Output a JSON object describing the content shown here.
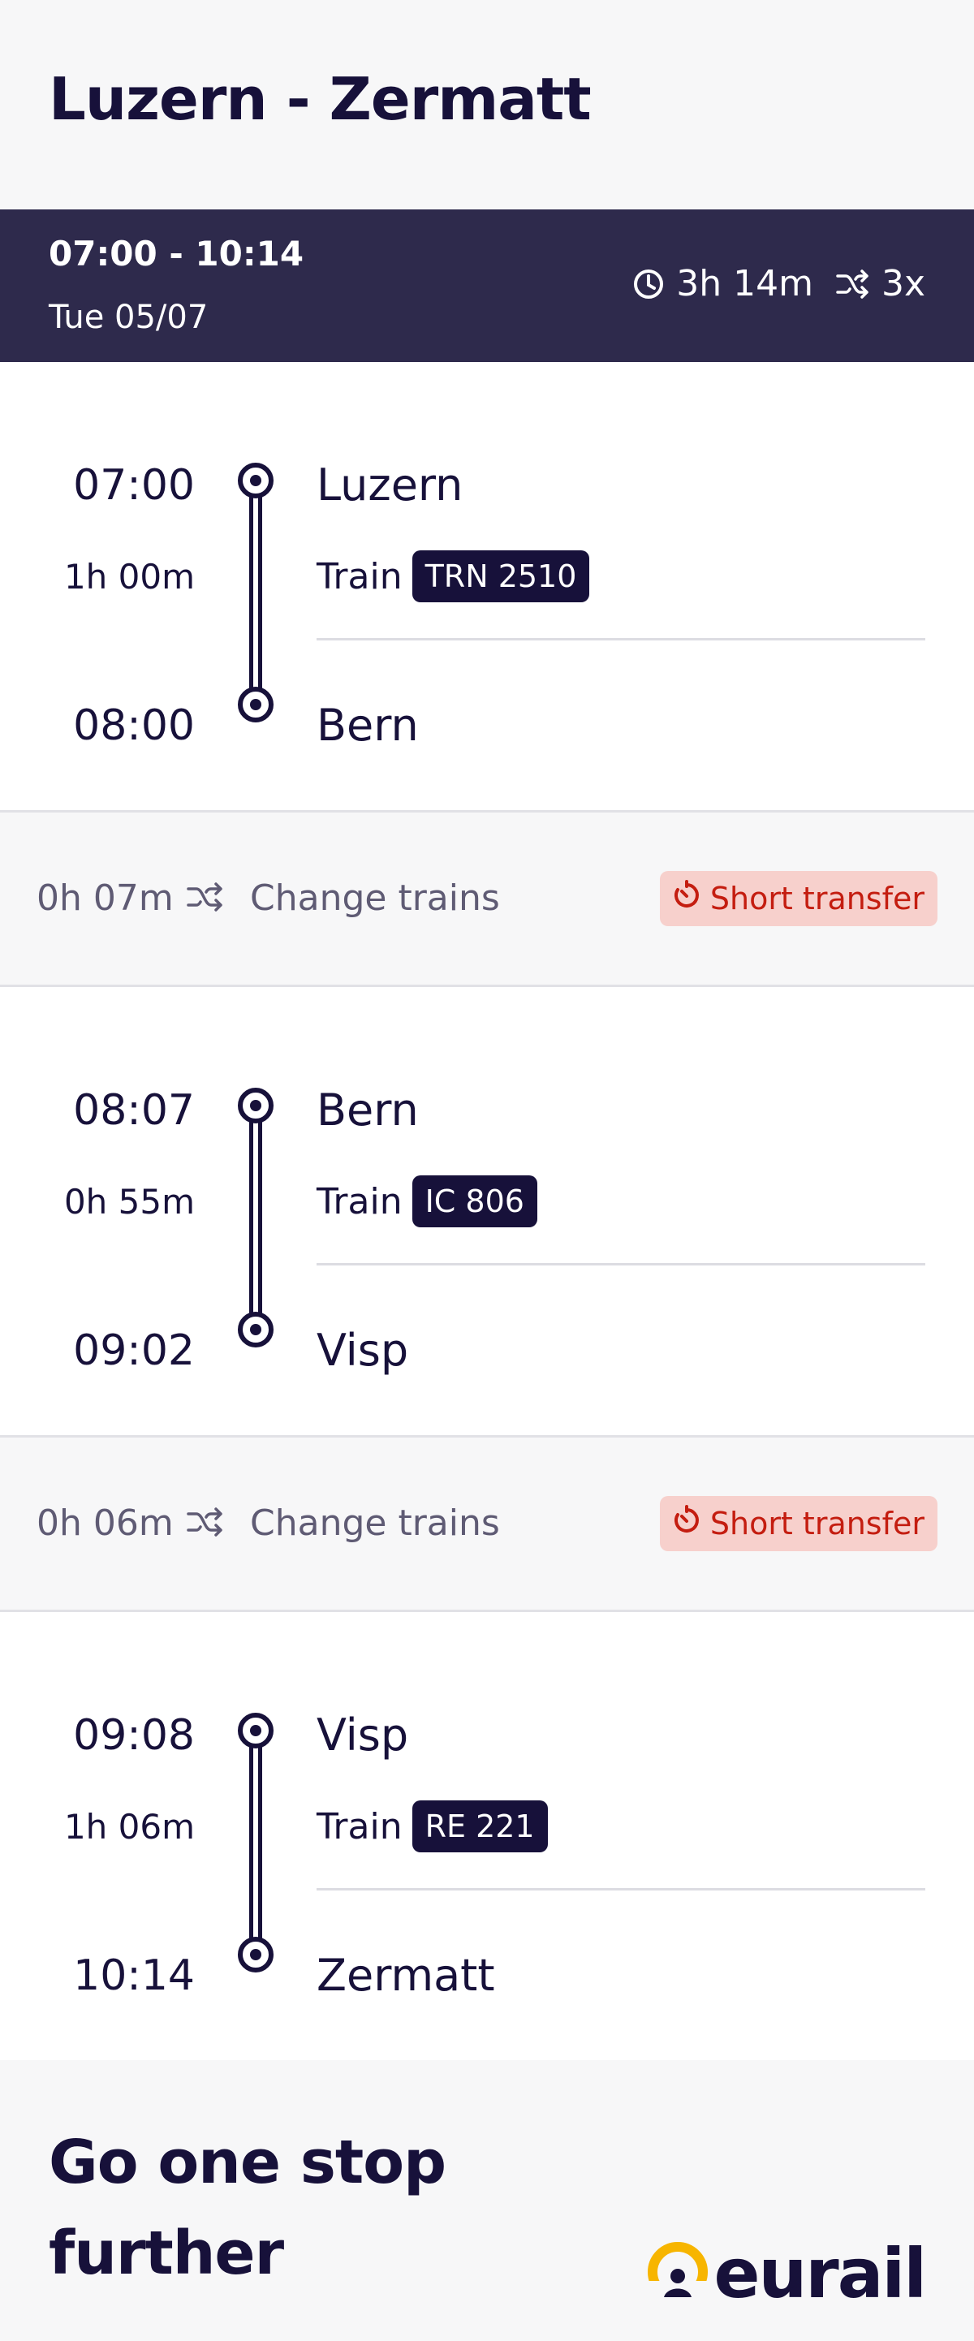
{
  "route": {
    "title": "Luzern - Zermatt"
  },
  "summary": {
    "time_range": "07:00 - 10:14",
    "date": "Tue 05/07",
    "duration": "3h 14m",
    "changes": "3x",
    "icons": [
      "clock-icon",
      "shuffle-icon"
    ]
  },
  "legs": [
    {
      "dep_time": "07:00",
      "duration": "1h 00m",
      "arr_time": "08:00",
      "from": "Luzern",
      "to": "Bern",
      "mode": "Train",
      "train": "TRN 2510"
    },
    {
      "dep_time": "08:07",
      "duration": "0h 55m",
      "arr_time": "09:02",
      "from": "Bern",
      "to": "Visp",
      "mode": "Train",
      "train": "IC 806"
    },
    {
      "dep_time": "09:08",
      "duration": "1h 06m",
      "arr_time": "10:14",
      "from": "Visp",
      "to": "Zermatt",
      "mode": "Train",
      "train": "RE 221"
    }
  ],
  "transfers": [
    {
      "duration": "0h 07m",
      "label": "Change trains",
      "warning": "Short transfer"
    },
    {
      "duration": "0h 06m",
      "label": "Change trains",
      "warning": "Short transfer"
    }
  ],
  "footer": {
    "promo": "Go one stop further",
    "logo_text": "eurail"
  },
  "colors": {
    "navy": "#17113a",
    "summary_bg": "#2e2a4c",
    "warning_bg": "#f7d0cc",
    "warning_text": "#c41d10",
    "logo_yellow": "#f7b500"
  }
}
